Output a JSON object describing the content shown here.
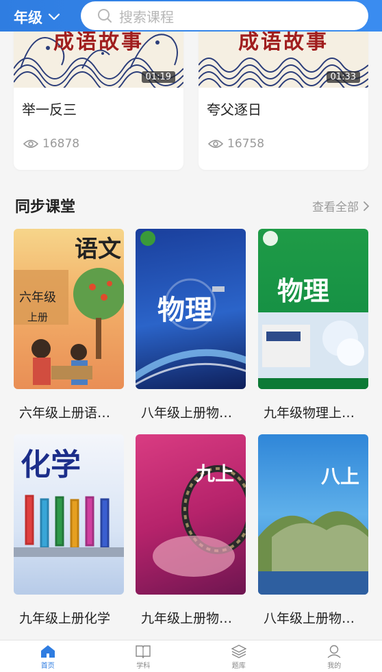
{
  "header": {
    "grade_label": "年级",
    "search_placeholder": "搜索课程"
  },
  "stories": [
    {
      "thumb_title": "成语故事",
      "duration": "01:19",
      "title": "举一反三",
      "views": "16878"
    },
    {
      "thumb_title": "成语故事",
      "duration": "01:33",
      "title": "夸父逐日",
      "views": "16758"
    }
  ],
  "section": {
    "title": "同步课堂",
    "see_all": "查看全部"
  },
  "books": [
    {
      "label": "六年级上册语…",
      "cover_text": "语文",
      "cover_sub": "六年级",
      "cover_sub2": "上册"
    },
    {
      "label": "八年级上册物…",
      "cover_text": "物理"
    },
    {
      "label": "九年级物理上…",
      "cover_text": "物理"
    },
    {
      "label": "九年级上册化学",
      "cover_text": "化学"
    },
    {
      "label": "九年级上册物…",
      "cover_text": "九上"
    },
    {
      "label": "八年级上册物…",
      "cover_text": "八上"
    }
  ],
  "tabs": [
    {
      "label": "首页",
      "icon": "home-icon",
      "active": true
    },
    {
      "label": "学科",
      "icon": "book-icon",
      "active": false
    },
    {
      "label": "题库",
      "icon": "layers-icon",
      "active": false
    },
    {
      "label": "我的",
      "icon": "user-icon",
      "active": false
    }
  ],
  "colors": {
    "accent": "#2f7de1",
    "background": "#f5f5f5"
  }
}
